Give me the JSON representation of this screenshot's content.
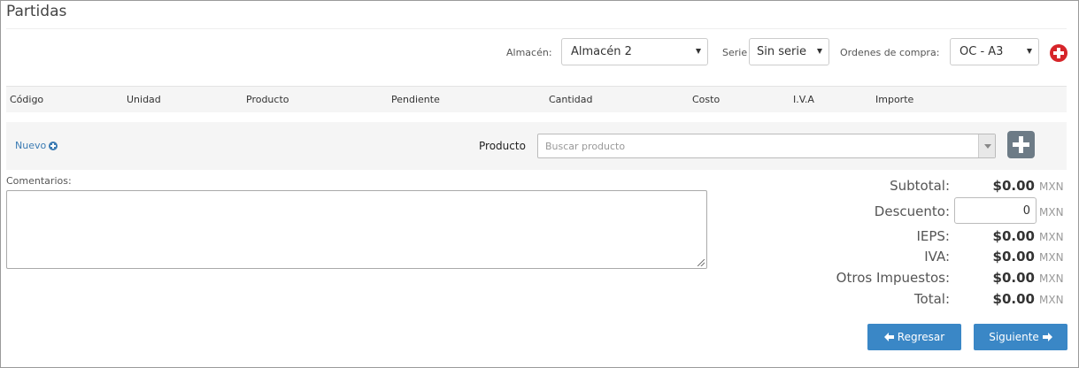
{
  "title": "Partidas",
  "filters": {
    "almacen_label": "Almacén:",
    "almacen_value": "Almacén 2",
    "serie_label": "Serie",
    "serie_value": "Sin serie",
    "ordenes_label": "Ordenes de compra:",
    "ordenes_value": "OC - A3"
  },
  "table": {
    "headers": [
      "Código",
      "Unidad",
      "Producto",
      "Pendiente",
      "Cantidad",
      "Costo",
      "I.V.A",
      "Importe"
    ]
  },
  "new_row": {
    "nuevo_label": "Nuevo",
    "producto_label": "Producto",
    "search_placeholder": "Buscar producto"
  },
  "comments": {
    "label": "Comentarios:",
    "value": ""
  },
  "totals": {
    "currency": "MXN",
    "subtotal_label": "Subtotal:",
    "subtotal_value": "$0.00",
    "descuento_label": "Descuento:",
    "descuento_value": "0",
    "ieps_label": "IEPS:",
    "ieps_value": "$0.00",
    "iva_label": "IVA:",
    "iva_value": "$0.00",
    "otros_label": "Otros Impuestos:",
    "otros_value": "$0.00",
    "total_label": "Total:",
    "total_value": "$0.00"
  },
  "buttons": {
    "back": "Regresar",
    "next": "Siguiente"
  },
  "colors": {
    "primary": "#3a87c6",
    "danger": "#d6252a",
    "link": "#3b7bb3"
  }
}
